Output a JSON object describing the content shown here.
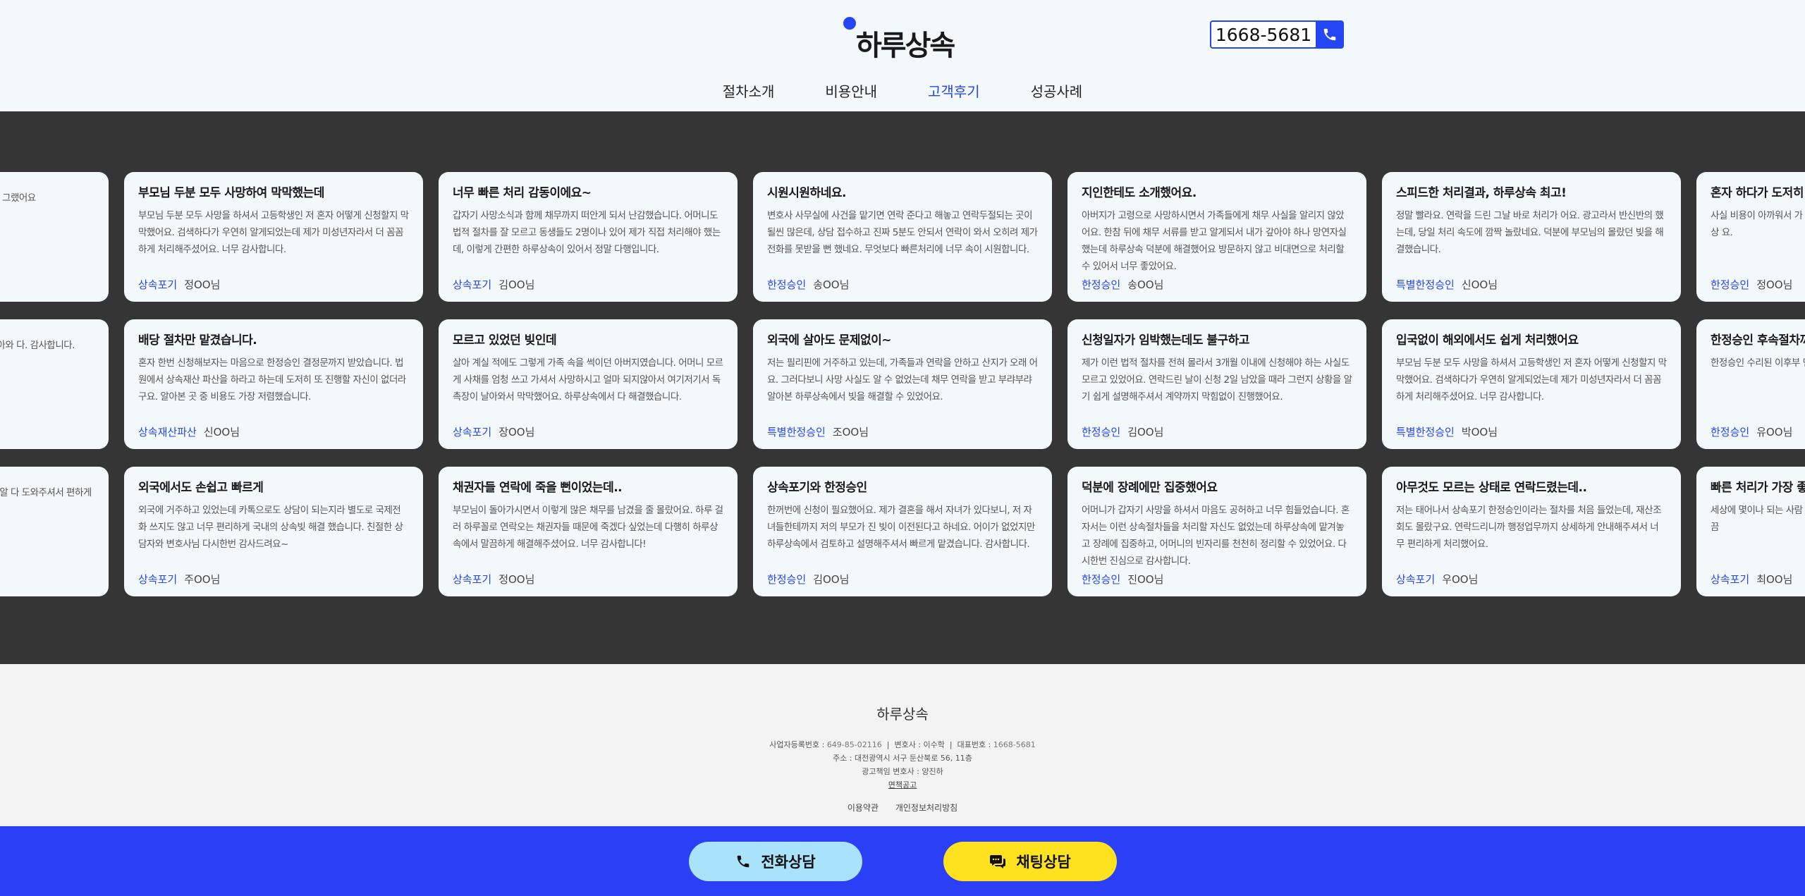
{
  "header": {
    "logo_text": "하루상속",
    "phone": "1668-5681",
    "nav": [
      "절차소개",
      "비용안내",
      "고객후기",
      "성공사례"
    ],
    "active_nav": 2
  },
  "colors": {
    "accent": "#2446f5",
    "band": "#353535",
    "cta_bar": "#2a3ff6",
    "call_btn": "#a9e3fb",
    "chat_btn": "#ffe21f"
  },
  "reviews": [
    [
      {
        "title": "",
        "body": "내려와서 막막해지더 인이었는데, 세상에 깔 엄 그랬어요",
        "tag": "",
        "name": ""
      },
      {
        "title": "부모님 두분 모두 사망하여 막막했는데",
        "body": "부모님 두분 모두 사망을 하셔서 고등학생인 저 혼자 어떻게 신청할지 막막했어요. 검색하다가 우연히 알게되었는데 제가 미성년자라서 더 꼼꼼하게 처리해주셨어요. 너무 감사합니다.",
        "tag": "상속포기",
        "name": "정OO님"
      },
      {
        "title": "너무 빠른 처리 감동이에요~",
        "body": "갑자기 사망소식과 함께 채무까지 떠안게 되서 난감했습니다. 어머니도 법적 절차를 잘 모르고 동생들도 2명이나 있어 제가 직접 처리해야 했는데, 이렇게 간편한 하루상속이 있어서 정말 다행입니다.",
        "tag": "상속포기",
        "name": "김OO님"
      },
      {
        "title": "시원시원하네요.",
        "body": "변호사 사무실에 사건을 맡기면 연락 준다고 해놓고 연락두절되는 곳이 될씬 많은데, 상담 접수하고 진짜 5분도 안되서 연락이 와서 오히려 제가 전화를 못받을 뻔 했네요. 무엇보다 빠른처리에 너무 속이 시원합니다.",
        "tag": "한정승인",
        "name": "송OO님"
      },
      {
        "title": "지인한테도 소개했어요.",
        "body": "아버지가 고령으로 사망하시면서 가족들에게 채무 사실을 알리지 않았어요. 한참 뒤에 채무 서류를 받고 알게되서 내가 갚아야 하나 망연자실 했는데 하루상속 덕분에 해결했어요 방문하지 않고 비대면으로 처리할 수 있어서 너무 좋았어요.",
        "tag": "한정승인",
        "name": "송OO님"
      },
      {
        "title": "스피드한 처리결과, 하루상속 최고!",
        "body": "정말 빨라요. 연락을 드린 그날 바로 처리가 어요. 광고라서 반신반의 했는데, 당일 처리 속도에 깜짝 놀랐네요. 덕분에 부모님의 몰랐던 빚을 해결했습니다.",
        "tag": "특별한정승인",
        "name": "신OO님"
      },
      {
        "title": "혼자 하다가 도저히 안되어서",
        "body": "사실 비용이 아까워서 가 명받아서 오갔는지 모르 그러다가 중간에 하루상 요.",
        "tag": "한정승인",
        "name": "정OO님"
      }
    ],
    [
      {
        "title": "",
        "body": "채무가 적었으면 어머니가 일찌리 대여금이 날아와 다. 감사합니다.",
        "tag": "",
        "name": ""
      },
      {
        "title": "배당 절차만 맡겼습니다.",
        "body": "혼자 한번 신청해보자는 마음으로 한정승인 결정문까지 받았습니다. 법원에서 상속재산 파산을 하라고 하는데 도저히 또 진행할 자신이 없더라구요. 알아본 곳 중 비용도 가장 저렴했습니다.",
        "tag": "상속재산파산",
        "name": "신OO님"
      },
      {
        "title": "모르고 있었던 빚인데",
        "body": "살아 계실 적에도 그렇게 가족 속을 썩이던 아버지였습니다. 어머니 모르게 사채를 엄청 쓰고 가셔서 사망하시고 얼마 되지않아서 여기저기서 독촉장이 날아와서 막막했어요. 하루상속에서 다 해결했습니다.",
        "tag": "상속포기",
        "name": "장OO님"
      },
      {
        "title": "외국에 살아도 문제없이~",
        "body": "저는 필리핀에 거주하고 있는데, 가족들과 연락을 안하고 산지가 오래 어요. 그러다보니 사망 사실도 알 수 없었는데 채무 연락을 받고 부랴부랴 알아본 하루상속에서 빚을 해결할 수 있었어요.",
        "tag": "특별한정승인",
        "name": "조OO님"
      },
      {
        "title": "신청일자가 임박했는데도 불구하고",
        "body": "제가 이런 법적 절차를 전혀 몰라서 3개월 이내에 신청해야 하는 사실도 모르고 있었어요. 연락드린 날이 신청 2일 남았을 때라 그런지 상황을 알기 쉽게 설명해주셔서 계약까지 막힘없이 진행했어요.",
        "tag": "한정승인",
        "name": "김OO님"
      },
      {
        "title": "입국없이 해외에서도 쉽게 처리했어요",
        "body": "부모님 두분 모두 사망을 하셔서 고등학생인 저 혼자 어떻게 신청할지 막막했어요. 검색하다가 우연히 알게되었는데 제가 미성년자라서 더 꼼꼼하게 처리해주셨어요. 너무 감사합니다.",
        "tag": "특별한정승인",
        "name": "박OO님"
      },
      {
        "title": "한정승인 후속절차까지",
        "body": "한정승인 수리된 이후부 면 그냥 한정승인 시작부 버렸네요.",
        "tag": "한정승인",
        "name": "유OO님"
      }
    ],
    [
      {
        "title": "",
        "body": "너무 슬퍼서 아무것도 할 추천으로 하루상속을 알 다 도와주셔서 편하게 동",
        "tag": "",
        "name": ""
      },
      {
        "title": "외국에서도 손쉽고 빠르게",
        "body": "외국에 거주하고 있었는데 카톡으로도 상담이 되는지라 별도로 국제전화 쓰지도 않고 너무 편리하게 국내의 상속빚 해결 했습니다. 친절한 상담자와 변호사님 다시한번 감사드려요~",
        "tag": "상속포기",
        "name": "주OO님"
      },
      {
        "title": "채권자들 연락에 죽을 뻔이었는데..",
        "body": "부모님이 돌아가시면서 이렇게 많은 채무를 남겼을 줄 몰랐어요. 하루 걸러 하루꼴로 연락오는 채권자들 때문에 죽겠다 싶었는데 다행히 하루상속에서 말끔하게 해결해주셨어요. 너무 감사합니다!",
        "tag": "상속포기",
        "name": "정OO님"
      },
      {
        "title": "상속포기와 한정승인",
        "body": "한꺼번에 신청이 필요했어요. 제가 결혼을 해서 자녀가 있다보니, 저 자녀들한테까지 저의 부모가 진 빚이 이전된다고 하네요. 어이가 없었지만 하루상속에서 검토하고 설명해주셔서 빠르게 맡겼습니다. 감사합니다.",
        "tag": "한정승인",
        "name": "김OO님"
      },
      {
        "title": "덕분에 장례에만 집중했어요",
        "body": "어머니가 갑자기 사망을 하셔서 마음도 공허하고 너무 힘들었습니다. 혼자서는 이런 상속절차들을 처리할 자신도 없었는데 하루상속에 맡겨놓고 장례에 집중하고, 어머니의 빈자리를 천천히 정리할 수 있었어요. 다시한번 진심으로 감사합니다.",
        "tag": "한정승인",
        "name": "진OO님"
      },
      {
        "title": "아무것도 모르는 상태로 연락드렸는데..",
        "body": "저는 태어나서 상속포기 한정승인이라는 절차를 처음 들었는데, 재산조회도 몰랐구요. 연락드리니까 행정업무까지 상세하게 안내해주셔서 너무 편리하게 처리했어요.",
        "tag": "상속포기",
        "name": "우OO님"
      },
      {
        "title": "빠른 처리가 가장 좋았",
        "body": "세상에 몇이나 되는 사람 라도 그건 싫죠. 채무를 리 덕분에 빚 문제를 깔끔",
        "tag": "상속포기",
        "name": "최OO님"
      }
    ]
  ],
  "footer": {
    "brand": "하루상속",
    "biz_label": "사업자등록번호 :",
    "biz_value": "649-85-02116",
    "lawyer": "변호사 : 이수학",
    "rep_label": "대표번호 :",
    "rep_value": "1668-5681",
    "address": "주소 : 대전광역시 서구 둔산북로 56, 11층",
    "ad_manager": "광고책임 변호사 : 양진하",
    "disclaimer": "면책공고",
    "terms": "이용약관",
    "privacy": "개인정보처리방침"
  },
  "cta": {
    "call_label": "전화상담",
    "chat_label": "채팅상담"
  }
}
